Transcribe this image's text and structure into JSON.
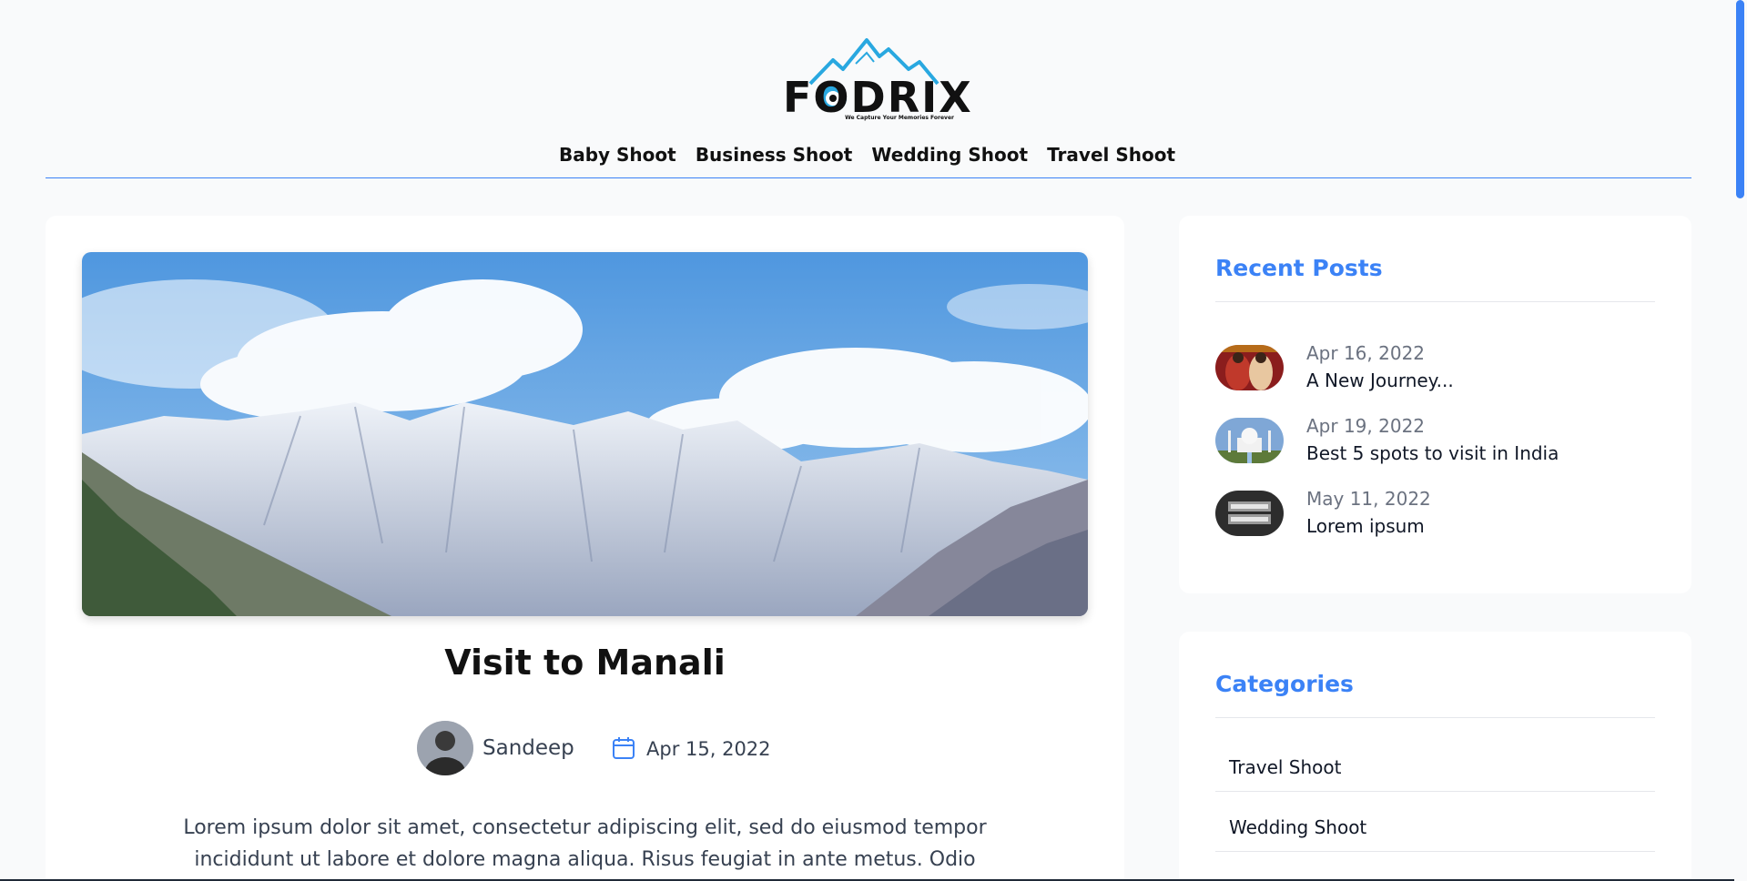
{
  "brand": {
    "logo_text": "FODRIX",
    "tagline": "We Capture Your Memories Forever",
    "colors": {
      "logo_blue": "#29a8e0",
      "logo_dark": "#111111"
    }
  },
  "nav": {
    "items": [
      {
        "label": "Baby Shoot"
      },
      {
        "label": "Business Shoot"
      },
      {
        "label": "Wedding Shoot"
      },
      {
        "label": "Travel Shoot"
      }
    ]
  },
  "post": {
    "image_alt": "Snow-capped mountains under blue sky",
    "title": "Visit to Manali",
    "author": "Sandeep",
    "date": "Apr 15, 2022",
    "excerpt": "Lorem ipsum dolor sit amet, consectetur adipiscing elit, sed do eiusmod tempor incididunt ut labore et dolore magna aliqua. Risus feugiat in ante metus. Odio"
  },
  "sidebar": {
    "recent": {
      "title": "Recent Posts",
      "items": [
        {
          "date": "Apr 16, 2022",
          "title": "A New Journey...",
          "thumb": "wedding-thumb"
        },
        {
          "date": "Apr 19, 2022",
          "title": "Best 5 spots to visit in India",
          "thumb": "taj-mahal-thumb"
        },
        {
          "date": "May 11, 2022",
          "title": "Lorem ipsum",
          "thumb": "lorem-ipsum-thumb"
        }
      ]
    },
    "categories": {
      "title": "Categories",
      "items": [
        {
          "label": "Travel Shoot"
        },
        {
          "label": "Wedding Shoot"
        }
      ]
    }
  },
  "theme": {
    "accent": "#3b82f6",
    "background": "#f9fafb",
    "card": "#ffffff"
  }
}
